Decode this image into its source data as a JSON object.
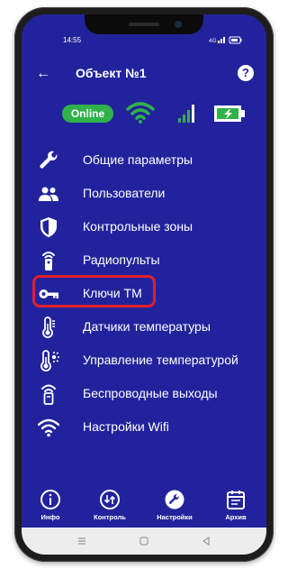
{
  "status_bar": {
    "time": "14:55",
    "indicators": "☉ııı ▁▃▅ ▭"
  },
  "header": {
    "title": "Объект №1",
    "help": "?"
  },
  "connection": {
    "online_label": "Online",
    "online_color": "#2fb24a"
  },
  "icons": {
    "back": "←"
  },
  "menu": {
    "items": [
      {
        "label": "Общие параметры",
        "icon": "wrench-icon"
      },
      {
        "label": "Пользователи",
        "icon": "users-icon"
      },
      {
        "label": "Контрольные зоны",
        "icon": "shield-icon"
      },
      {
        "label": "Радиопульты",
        "icon": "remote-icon"
      },
      {
        "label": "Ключи ТМ",
        "icon": "key-icon"
      },
      {
        "label": "Датчики температуры",
        "icon": "thermometer-icon"
      },
      {
        "label": "Управление температурой",
        "icon": "thermostat-icon"
      },
      {
        "label": "Беспроводные выходы",
        "icon": "wireless-output-icon"
      },
      {
        "label": "Настройки Wifi",
        "icon": "wifi-icon"
      }
    ]
  },
  "bottom_nav": {
    "items": [
      {
        "label": "Инфо",
        "icon": "info-icon"
      },
      {
        "label": "Контроль",
        "icon": "control-icon"
      },
      {
        "label": "Настройки",
        "icon": "settings-icon",
        "active": true
      },
      {
        "label": "Архив",
        "icon": "calendar-icon"
      }
    ]
  },
  "colors": {
    "background": "#22239c",
    "accent": "#ffffff",
    "highlight": "#e0202a"
  }
}
